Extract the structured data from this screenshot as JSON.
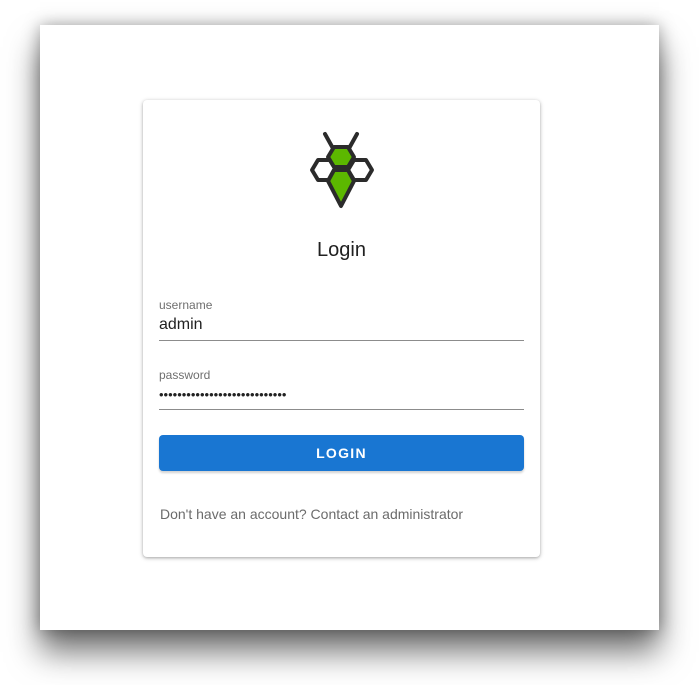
{
  "login": {
    "title": "Login",
    "username": {
      "label": "username",
      "value": "admin"
    },
    "password": {
      "label": "password",
      "value": "••••••••••••••••••••••••••••"
    },
    "button_label": "LOGIN",
    "footer": "Don't have an account? Contact an administrator"
  },
  "logo": {
    "icon": "bee-hexagon-logo",
    "colors": {
      "outline": "#2b2b2b",
      "fill": "#5cb800"
    }
  },
  "colors": {
    "primary": "#1976d2"
  }
}
